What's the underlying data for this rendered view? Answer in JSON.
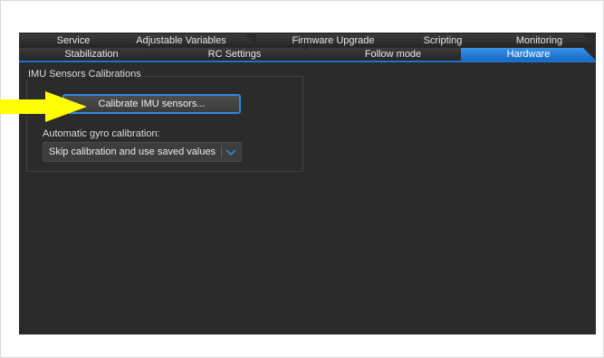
{
  "tabs": {
    "row1": [
      "Service",
      "Adjustable Variables",
      "Firmware Upgrade",
      "Scripting",
      "Monitoring"
    ],
    "row2": [
      "Stabilization",
      "RC Settings",
      "Follow mode",
      "Hardware"
    ],
    "active": "Hardware"
  },
  "imu_group": {
    "title": "IMU Sensors Calibrations",
    "calibrate_button": "Calibrate IMU sensors...",
    "auto_gyro_label": "Automatic gyro calibration:",
    "auto_gyro_selected": "Skip calibration and use saved values"
  },
  "colors": {
    "accent": "#1e73cf",
    "panel_bg": "#2b2b2b",
    "annotation_arrow": "#ffff00"
  },
  "icons": {
    "dropdown": "chevron-down-icon",
    "annotation": "yellow-arrow-icon"
  }
}
